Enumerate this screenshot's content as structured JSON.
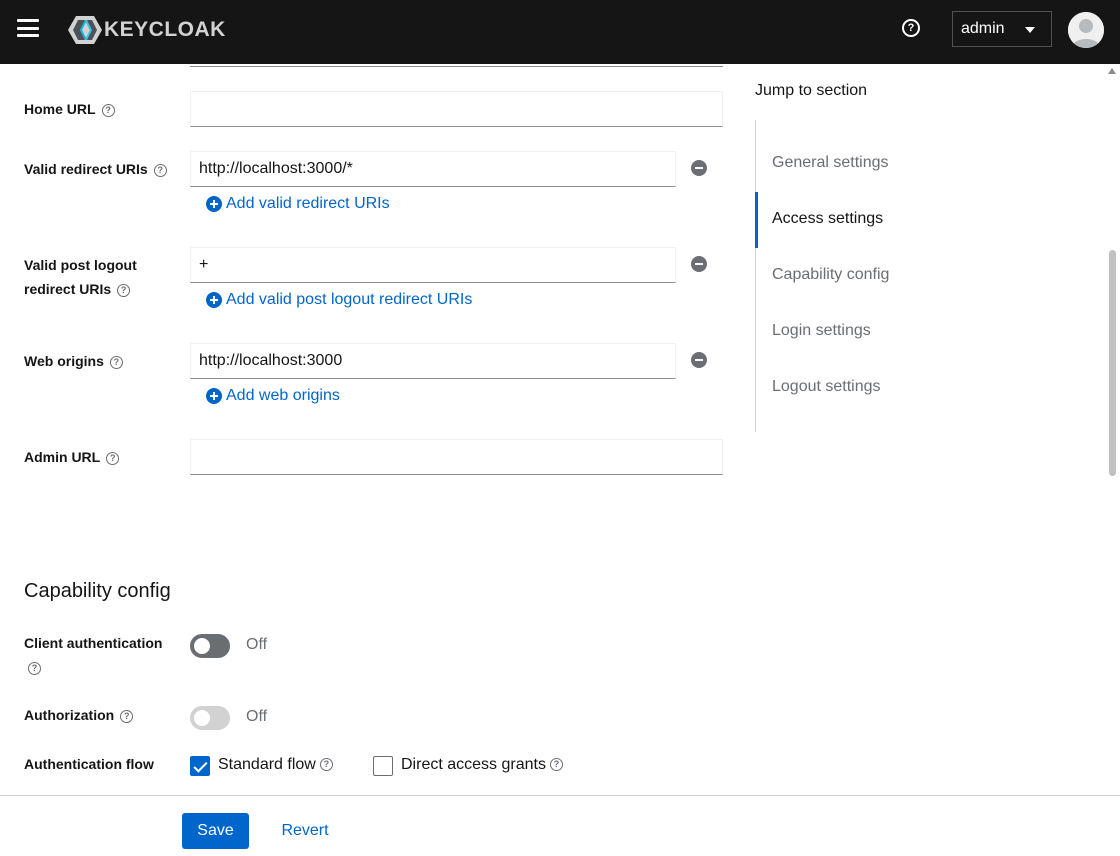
{
  "header": {
    "brand": "KEYCLOAK",
    "user_menu": "admin",
    "icons": {
      "menu": "hamburger-icon",
      "help": "help-circle-icon",
      "avatar": "user-avatar-icon"
    }
  },
  "form": {
    "home_url": {
      "label": "Home URL",
      "value": ""
    },
    "valid_redirect_uris": {
      "label": "Valid redirect URIs",
      "value": "http://localhost:3000/*",
      "add_label": "Add valid redirect URIs"
    },
    "valid_post_logout": {
      "label_line1": "Valid post logout",
      "label_line2": "redirect URIs",
      "value": "+",
      "add_label": "Add valid post logout redirect URIs"
    },
    "web_origins": {
      "label": "Web origins",
      "value": "http://localhost:3000",
      "add_label": "Add web origins"
    },
    "admin_url": {
      "label": "Admin URL",
      "value": ""
    }
  },
  "capability": {
    "title": "Capability config",
    "client_auth": {
      "label": "Client authentication",
      "state": "Off"
    },
    "authorization": {
      "label": "Authorization",
      "state": "Off"
    },
    "auth_flow": {
      "label": "Authentication flow",
      "standard_flow": {
        "label": "Standard flow",
        "checked": true
      },
      "direct_access": {
        "label": "Direct access grants",
        "checked": false
      }
    }
  },
  "jump": {
    "title": "Jump to section",
    "items": [
      "General settings",
      "Access settings",
      "Capability config",
      "Login settings",
      "Logout settings"
    ],
    "active": "Access settings"
  },
  "footer": {
    "save": "Save",
    "revert": "Revert"
  },
  "colors": {
    "primary": "#0066cc",
    "masthead": "#151515"
  }
}
